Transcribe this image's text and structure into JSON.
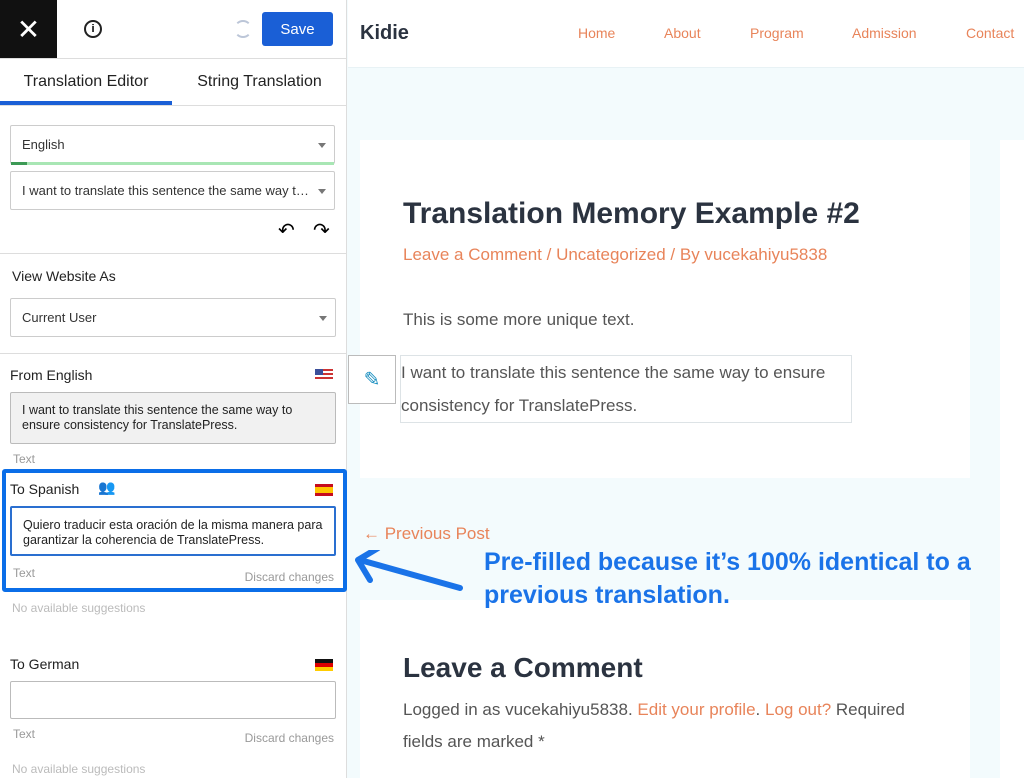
{
  "panel": {
    "save_label": "Save",
    "tabs": [
      "Translation Editor",
      "String Translation"
    ],
    "language_select": "English",
    "string_select": "I want to translate this sentence the same way to ...",
    "view_as_label": "View Website As",
    "view_as_value": "Current User",
    "from_label": "From English",
    "from_text": "I want to translate this sentence the same way to ensure consistency for TranslatePress.",
    "from_type": "Text",
    "spanish_label": "To Spanish",
    "spanish_text": "Quiero traducir esta oración de la misma manera para garantizar la coherencia de TranslatePress.",
    "spanish_type": "Text",
    "discard": "Discard changes",
    "no_suggestions": "No available suggestions",
    "german_label": "To German",
    "german_text": "",
    "german_type": "Text",
    "german_discard": "Discard changes",
    "german_no_suggestions": "No available suggestions"
  },
  "site": {
    "logo": "Kidie",
    "nav": [
      "Home",
      "About",
      "Program",
      "Admission",
      "Contact"
    ],
    "title": "Translation Memory Example #2",
    "meta": "Leave a Comment / Uncategorized / By vucekahiyu5838",
    "para1": "This is some more unique text.",
    "para2": "I want to translate this sentence the same way to ensure consistency for TranslatePress.",
    "prev_post": "← Previous Post",
    "comment_title": "Leave a Comment",
    "logged_in": "Logged in as vucekahiyu5838. ",
    "edit_profile": "Edit your profile",
    "dot": ". ",
    "logout": "Log out?",
    "required": " Required fields are marked *"
  },
  "annotation": "Pre-filled because it’s 100% identical to a previous translation.",
  "colors": {
    "accent": "#1a5fd6",
    "annotation": "#1a73e8",
    "link": "#e8845a"
  }
}
